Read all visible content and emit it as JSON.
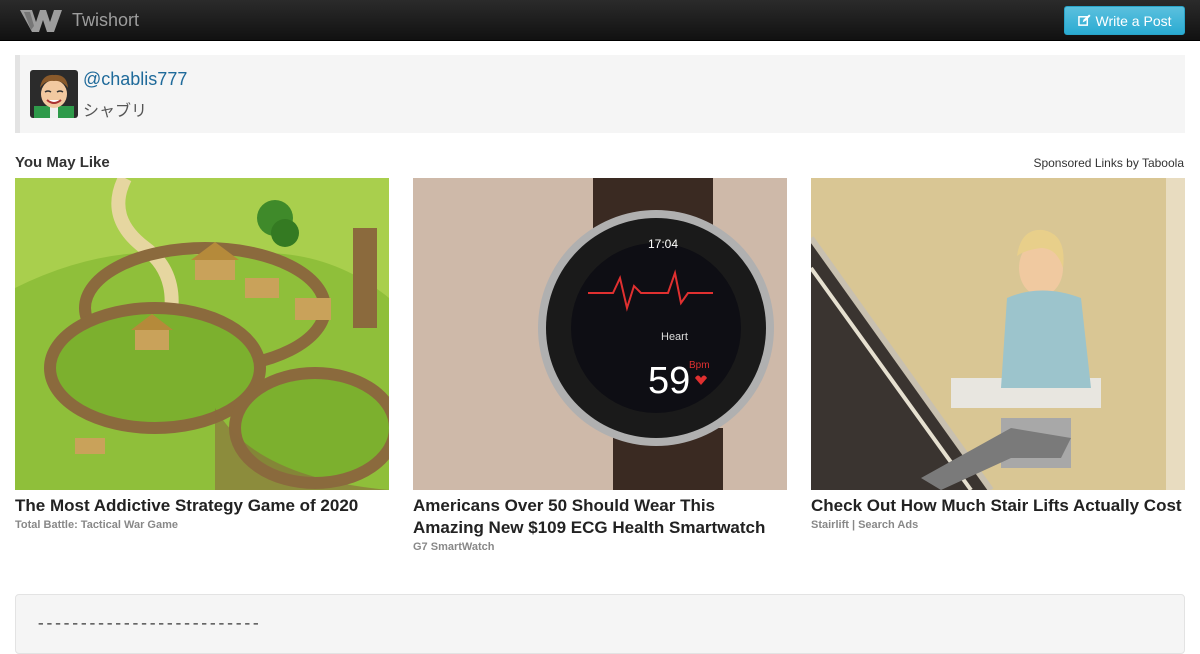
{
  "navbar": {
    "brand": "Twishort",
    "write_button": "Write a Post",
    "logo_icon": "twishort-logo-icon",
    "write_icon": "edit-icon"
  },
  "author": {
    "handle": "@chablis777",
    "name": "シャブリ"
  },
  "recommendations": {
    "title": "You May Like",
    "sponsored": "Sponsored Links by Taboola",
    "items": [
      {
        "title": "The Most Addictive Strategy Game of 2020",
        "source": "Total Battle: Tactical War Game"
      },
      {
        "title": "Americans Over 50 Should Wear This Amazing New $109 ECG Health Smartwatch",
        "source": "G7 SmartWatch"
      },
      {
        "title": "Check Out How Much Stair Lifts Actually Cost",
        "source": "Stairlift | Search Ads"
      }
    ]
  },
  "watch": {
    "time": "17:04",
    "label": "Heart",
    "bpm": "59",
    "unit": "Bpm"
  },
  "post": {
    "text": "--------------------------"
  },
  "colors": {
    "accent": "#5bc0de",
    "link": "#1f6a9a",
    "navbar": "#1b1b1b"
  }
}
